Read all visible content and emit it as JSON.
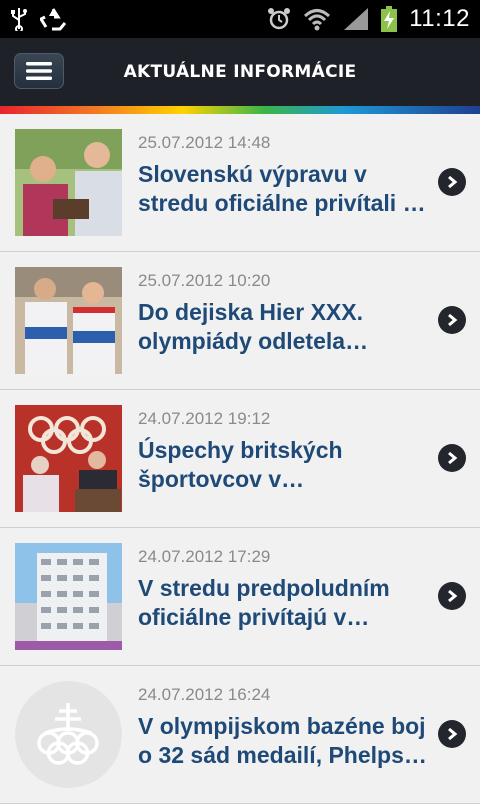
{
  "status": {
    "time": "11:12"
  },
  "header": {
    "title": "AKTUÁLNE INFORMÁCIE"
  },
  "news": [
    {
      "date": "25.07.2012 14:48",
      "title": "Slovenskú výpravu v stredu oficiálne privítali …"
    },
    {
      "date": "25.07.2012 10:20",
      "title": "Do dejiska Hier XXX. olympiády odletela ďalši…"
    },
    {
      "date": "24.07.2012 19:12",
      "title": "Úspechy britských športovcov v posledných…"
    },
    {
      "date": "24.07.2012 17:29",
      "title": "V stredu predpoludním oficiálne privítajú v…"
    },
    {
      "date": "24.07.2012 16:24",
      "title": "V olympijskom bazéne boj o 32 sád medailí, Phelps…"
    }
  ]
}
